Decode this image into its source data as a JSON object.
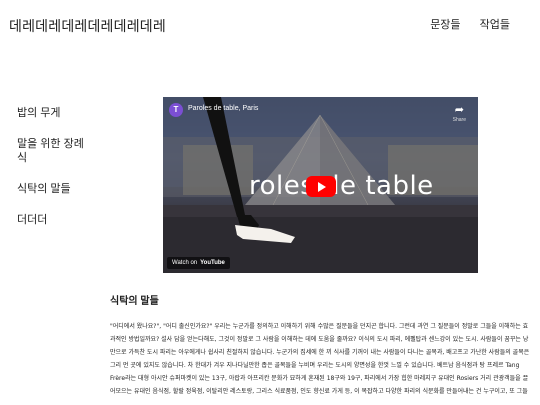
{
  "header": {
    "site_title": "데레데레데레데레데레데레",
    "nav": [
      "문장들",
      "작업들"
    ]
  },
  "sidebar": {
    "items": [
      "밥의 무게",
      "말을 위한 장례식",
      "식탁의 말들",
      "더더더"
    ]
  },
  "video": {
    "channel_initial": "T",
    "title": "Paroles de table, Paris",
    "share_label": "Share",
    "overlay_text": "roles de table",
    "watch_on": "Watch on",
    "youtube": "YouTube"
  },
  "article": {
    "title": "식탁의 말들",
    "body": "\"어디에서 왔나요?\", \"어디 출신인가요?\" 우리는 누군가를 정의하고 이해하기 위해 수많은 질문들을 던지곤 합니다. 그런데 과연 그 질문들이 정말로 그들을 이해하는 효과적인 방법일까요? 설사 답을 얻는다해도, 그것이 정말로 그 사람을 이해하는 데에 도움을 줄까요? 이식의 도시 파리, 에펠탑과 센느강이 있는 도시. 사람들이 꿈꾸는 낭만으로 가득찬 도시 파리는 아우에게나 쉽사리 친절하지 않습니다. 누군가의 집세에 한 끼 식사를 기꺼이 내는 사람들이 다니는 골목과, 배고프고 가난한 사람들의 골목은 그리 먼 곳에 있지도 않습니다. 차 한대가 겨우 지나다닐만한 좁은 골목들을 누비며 우리는 도시의 양면성을 한껏 느낄 수 있습니다. 베트남 음식점과 탕 프레르 Tang Frère라는 대형 아시안 슈퍼마켓이 있는 13구, 아랍과 아프리칸 문화가 묘하게 혼재된 18구와 19구, 파리에서 가장 힙한 마레지구 유대인 Rosiers 거리 관광객들을 끌어모으는 유대인 음식점, 할랄 정육점, 이탈리안 레스토랑, 그리스 식료품점, 인도 향신료 가게 등, 이 복잡하고 다양한 파리의 식문화를 만들어내는 건 누구이고, 또 그들"
  }
}
